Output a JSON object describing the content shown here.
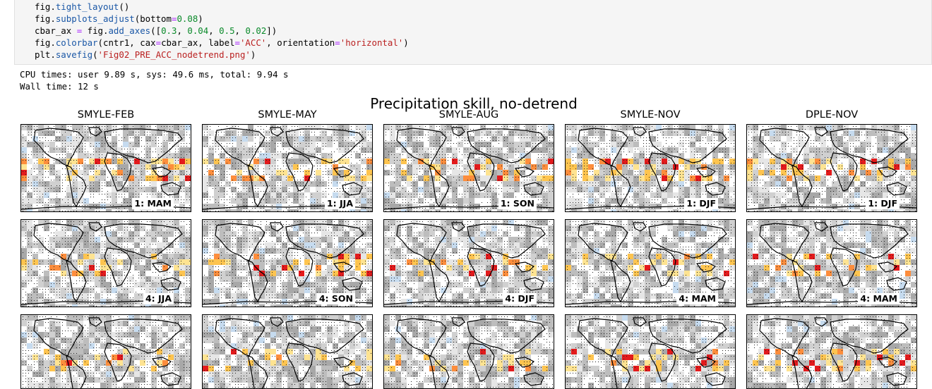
{
  "code_lines": [
    [
      {
        "t": "fig.",
        "c": ""
      },
      {
        "t": "tight_layout",
        "c": "fn"
      },
      {
        "t": "()",
        "c": ""
      }
    ],
    [
      {
        "t": "fig.",
        "c": ""
      },
      {
        "t": "subplots_adjust",
        "c": "fn"
      },
      {
        "t": "(bottom",
        "c": ""
      },
      {
        "t": "=",
        "c": "op"
      },
      {
        "t": "0.08",
        "c": "num"
      },
      {
        "t": ")",
        "c": ""
      }
    ],
    [
      {
        "t": "cbar_ax ",
        "c": ""
      },
      {
        "t": "=",
        "c": "op"
      },
      {
        "t": " fig.",
        "c": ""
      },
      {
        "t": "add_axes",
        "c": "fn"
      },
      {
        "t": "([",
        "c": ""
      },
      {
        "t": "0.3",
        "c": "num"
      },
      {
        "t": ", ",
        "c": ""
      },
      {
        "t": "0.04",
        "c": "num"
      },
      {
        "t": ", ",
        "c": ""
      },
      {
        "t": "0.5",
        "c": "num"
      },
      {
        "t": ", ",
        "c": ""
      },
      {
        "t": "0.02",
        "c": "num"
      },
      {
        "t": "])",
        "c": ""
      }
    ],
    [
      {
        "t": "fig.",
        "c": ""
      },
      {
        "t": "colorbar",
        "c": "fn"
      },
      {
        "t": "(cntr1, cax",
        "c": ""
      },
      {
        "t": "=",
        "c": "op"
      },
      {
        "t": "cbar_ax, label",
        "c": ""
      },
      {
        "t": "=",
        "c": "op"
      },
      {
        "t": "'ACC'",
        "c": "str"
      },
      {
        "t": ", orientation",
        "c": ""
      },
      {
        "t": "=",
        "c": "op"
      },
      {
        "t": "'horizontal'",
        "c": "str"
      },
      {
        "t": ")",
        "c": ""
      }
    ],
    [
      {
        "t": "plt.",
        "c": ""
      },
      {
        "t": "savefig",
        "c": "fn"
      },
      {
        "t": "(",
        "c": ""
      },
      {
        "t": "'Fig02_PRE_ACC_nodetrend.png'",
        "c": "str"
      },
      {
        "t": ")",
        "c": ""
      }
    ]
  ],
  "output": {
    "cpu_times": "CPU times: user 9.89 s, sys: 49.6 ms, total: 9.94 s",
    "wall_time": "Wall time: 12 s"
  },
  "figure": {
    "title": "Precipitation skill, no-detrend",
    "columns": [
      "SMYLE-FEB",
      "SMYLE-MAY",
      "SMYLE-AUG",
      "SMYLE-NOV",
      "DPLE-NOV"
    ],
    "rows": [
      [
        "1: MAM",
        "1: JJA",
        "1: SON",
        "1: DJF",
        "1: DJF"
      ],
      [
        "4: JJA",
        "4: SON",
        "4: DJF",
        "4: MAM",
        "4: MAM"
      ],
      [
        "",
        "",
        "",
        "",
        ""
      ]
    ]
  },
  "colors": {
    "code_bg": "#f5f5f5",
    "function": "#1a57a6",
    "number": "#0a8a2a",
    "string": "#ba2121",
    "operator": "#aa22ff",
    "skill_high": "#d7301f",
    "skill_mid": "#fd8d3c",
    "skill_low": "#fee391",
    "skill_negative": "#9ecae1",
    "insignificant": "#bdbdbd"
  }
}
